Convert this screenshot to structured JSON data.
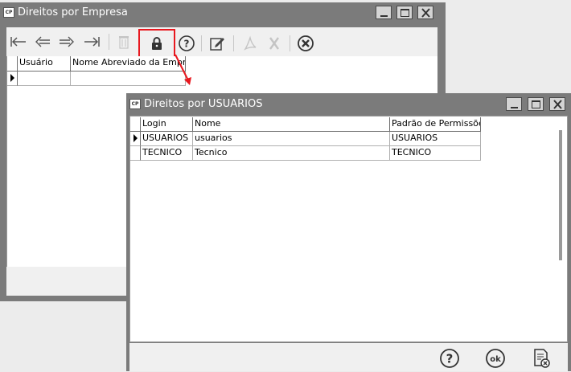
{
  "empresa_window": {
    "title": "Direitos por Empresa",
    "app_icon_text": "CP",
    "grid": {
      "columns": [
        "Usuário",
        "Nome Abreviado da Empresa"
      ]
    }
  },
  "usuarios_window": {
    "title": "Direitos por USUARIOS",
    "app_icon_text": "CP",
    "grid": {
      "columns": [
        "Login",
        "Nome",
        "Padrão de Permissões"
      ],
      "rows": [
        [
          "USUARIOS",
          "usuarios",
          "USUARIOS"
        ],
        [
          "TECNICO",
          "Tecnico",
          "TECNICO"
        ]
      ]
    }
  },
  "toolbar_icons": [
    "first-icon",
    "prev-icon",
    "next-icon",
    "last-icon",
    "delete-icon",
    "lock-icon",
    "help-icon",
    "edit-icon",
    "pdf-icon",
    "excel-icon",
    "close-icon"
  ],
  "footer_icons": [
    "help-icon",
    "ok-icon",
    "cancel-report-icon"
  ],
  "colors": {
    "titlebar": "#7b7b7b",
    "highlight": "#e8181f"
  }
}
